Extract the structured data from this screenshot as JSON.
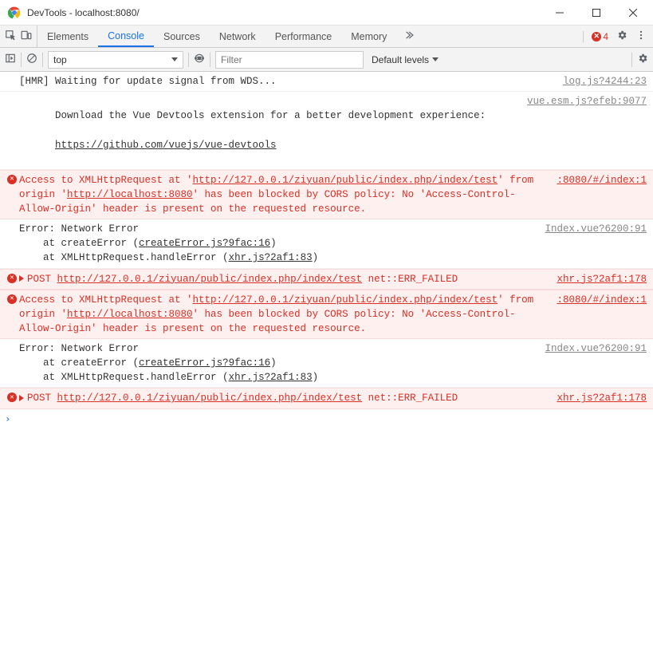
{
  "window": {
    "title": "DevTools - localhost:8080/"
  },
  "tabs": {
    "items": [
      "Elements",
      "Console",
      "Sources",
      "Network",
      "Performance",
      "Memory"
    ],
    "active_index": 1,
    "error_count": "4"
  },
  "filters": {
    "context": "top",
    "filter_placeholder": "Filter",
    "levels": "Default levels"
  },
  "logs": [
    {
      "type": "info",
      "text": "[HMR] Waiting for update signal from WDS...",
      "src": "log.js?4244:23"
    },
    {
      "type": "info-multi",
      "text": "Download the Vue Devtools extension for a better development experience:",
      "link": "https://github.com/vuejs/vue-devtools",
      "src": "vue.esm.js?efeb:9077"
    },
    {
      "type": "error-cors",
      "pre": "Access to XMLHttpRequest at '",
      "url1": "http://127.0.0.1/ziyuan/public/index.php/index/test",
      "mid": "' from origin '",
      "url2": "http://localhost:8080",
      "post": "' has been blocked by CORS policy: No 'Access-Control-Allow-Origin' header is present on the requested resource.",
      "src": ":8080/#/index:1"
    },
    {
      "type": "stack",
      "head": "Error: Network Error",
      "line1_pre": "    at createError (",
      "line1_link": "createError.js?9fac:16",
      "line1_post": ")",
      "line2_pre": "    at XMLHttpRequest.handleError (",
      "line2_link": "xhr.js?2af1:83",
      "line2_post": ")",
      "src": "Index.vue?6200:91"
    },
    {
      "type": "error-net",
      "method": "POST ",
      "url": "http://127.0.0.1/ziyuan/public/index.php/index/test",
      "status": " net::ERR_FAILED",
      "src": "xhr.js?2af1:178"
    },
    {
      "type": "error-cors",
      "pre": "Access to XMLHttpRequest at '",
      "url1": "http://127.0.0.1/ziyuan/public/index.php/index/test",
      "mid": "' from origin '",
      "url2": "http://localhost:8080",
      "post": "' has been blocked by CORS policy: No 'Access-Control-Allow-Origin' header is present on the requested resource.",
      "src": ":8080/#/index:1"
    },
    {
      "type": "stack",
      "head": "Error: Network Error",
      "line1_pre": "    at createError (",
      "line1_link": "createError.js?9fac:16",
      "line1_post": ")",
      "line2_pre": "    at XMLHttpRequest.handleError (",
      "line2_link": "xhr.js?2af1:83",
      "line2_post": ")",
      "src": "Index.vue?6200:91"
    },
    {
      "type": "error-net",
      "method": "POST ",
      "url": "http://127.0.0.1/ziyuan/public/index.php/index/test",
      "status": " net::ERR_FAILED",
      "src": "xhr.js?2af1:178"
    }
  ]
}
